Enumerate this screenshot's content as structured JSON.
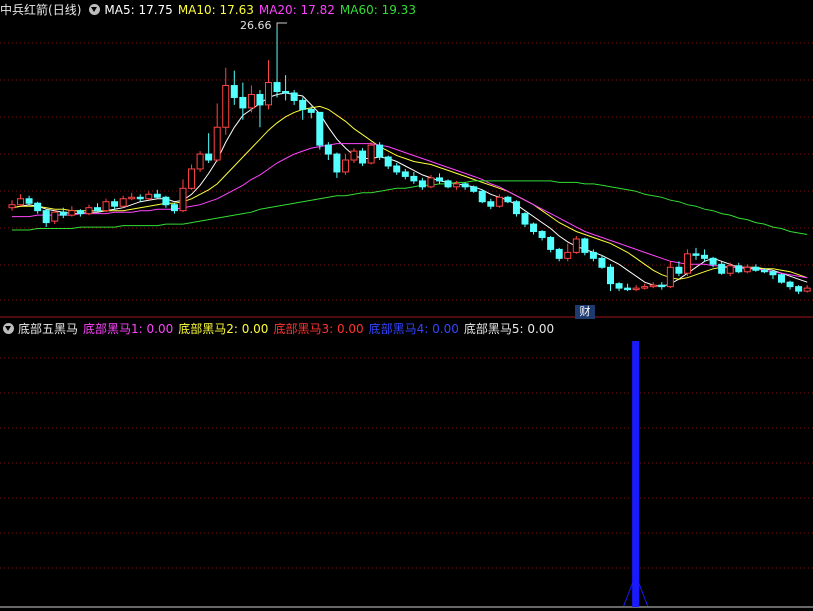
{
  "main_panel": {
    "stock_name": "中兵红箭",
    "period": "(日线)",
    "ma": [
      {
        "label": "MA5: 17.75",
        "color": "#ffffff"
      },
      {
        "label": "MA10: 17.63",
        "color": "#ffff3a"
      },
      {
        "label": "MA20: 17.82",
        "color": "#ff44ff"
      },
      {
        "label": "MA60: 19.33",
        "color": "#33dd33"
      }
    ],
    "peak_label": "26.66",
    "marker": "财"
  },
  "indicator_panel": {
    "name": "底部五黑马",
    "params": [
      {
        "label": "底部黑马1: 0.00",
        "color": "#ff44ff"
      },
      {
        "label": "底部黑马2: 0.00",
        "color": "#ffff3a"
      },
      {
        "label": "底部黑马3: 0.00",
        "color": "#ff3333"
      },
      {
        "label": "底部黑马4: 0.00",
        "color": "#3344ff"
      },
      {
        "label": "底部黑马5: 0.00",
        "color": "#e8e8e8"
      }
    ]
  },
  "colors": {
    "up": "#ff4444",
    "down": "#54ffff",
    "grid": "#7a1010",
    "signal_bar": "#1a1aff"
  },
  "chart_data": {
    "type": "candlestick",
    "candles": [
      [
        14.6,
        14.8,
        15.1,
        14.4
      ],
      [
        14.8,
        15.2,
        15.5,
        14.7
      ],
      [
        15.2,
        14.9,
        15.4,
        14.8
      ],
      [
        14.9,
        14.4,
        15.0,
        14.2
      ],
      [
        14.4,
        13.6,
        14.5,
        13.3
      ],
      [
        13.7,
        14.3,
        14.4,
        13.5
      ],
      [
        14.3,
        14.1,
        14.6,
        13.9
      ],
      [
        14.1,
        14.4,
        14.7,
        14.0
      ],
      [
        14.4,
        14.2,
        14.5,
        14.0
      ],
      [
        14.2,
        14.6,
        14.8,
        14.1
      ],
      [
        14.6,
        14.4,
        14.9,
        14.3
      ],
      [
        14.4,
        15.0,
        15.2,
        14.3
      ],
      [
        15.0,
        14.7,
        15.2,
        14.5
      ],
      [
        14.7,
        15.2,
        15.4,
        14.6
      ],
      [
        15.2,
        15.3,
        15.6,
        15.1
      ],
      [
        15.3,
        15.2,
        15.5,
        15.0
      ],
      [
        15.2,
        15.5,
        15.7,
        15.1
      ],
      [
        15.5,
        15.3,
        15.8,
        15.2
      ],
      [
        15.3,
        14.8,
        15.4,
        14.6
      ],
      [
        14.8,
        14.4,
        14.9,
        14.2
      ],
      [
        14.4,
        15.9,
        16.5,
        14.3
      ],
      [
        15.9,
        17.2,
        17.5,
        15.8
      ],
      [
        17.2,
        18.2,
        18.4,
        17.0
      ],
      [
        18.2,
        17.8,
        19.6,
        17.6
      ],
      [
        17.8,
        20.0,
        21.6,
        17.7
      ],
      [
        20.0,
        22.8,
        24.0,
        19.5
      ],
      [
        22.8,
        22.0,
        23.8,
        21.5
      ],
      [
        22.0,
        21.3,
        23.0,
        20.5
      ],
      [
        21.3,
        22.2,
        22.8,
        21.0
      ],
      [
        22.2,
        21.5,
        22.5,
        20.0
      ],
      [
        21.5,
        23.0,
        24.5,
        21.2
      ],
      [
        23.0,
        22.4,
        26.66,
        22.0
      ],
      [
        22.4,
        22.3,
        23.5,
        21.8
      ],
      [
        22.3,
        21.8,
        22.5,
        21.5
      ],
      [
        21.8,
        21.2,
        22.0,
        20.5
      ],
      [
        21.2,
        21.0,
        21.4,
        20.6
      ],
      [
        21.0,
        18.8,
        21.0,
        18.5
      ],
      [
        18.8,
        18.2,
        19.0,
        17.8
      ],
      [
        18.2,
        17.0,
        18.3,
        16.6
      ],
      [
        17.0,
        17.8,
        18.2,
        16.8
      ],
      [
        17.8,
        18.4,
        18.6,
        17.6
      ],
      [
        18.4,
        17.6,
        18.6,
        17.4
      ],
      [
        17.6,
        18.8,
        19.0,
        17.5
      ],
      [
        18.8,
        18.0,
        19.0,
        17.8
      ],
      [
        18.0,
        17.4,
        18.1,
        17.2
      ],
      [
        17.4,
        17.0,
        17.6,
        16.8
      ],
      [
        17.0,
        16.7,
        17.2,
        16.5
      ],
      [
        16.7,
        16.4,
        17.0,
        16.2
      ],
      [
        16.4,
        16.0,
        16.6,
        15.8
      ],
      [
        16.0,
        16.6,
        16.8,
        15.9
      ],
      [
        16.6,
        16.4,
        16.9,
        16.2
      ],
      [
        16.4,
        16.0,
        16.5,
        15.9
      ],
      [
        16.0,
        16.2,
        16.4,
        15.8
      ],
      [
        16.2,
        16.0,
        16.3,
        15.8
      ],
      [
        16.0,
        15.7,
        16.1,
        15.6
      ],
      [
        15.7,
        15.0,
        15.8,
        14.9
      ],
      [
        15.0,
        14.7,
        15.2,
        14.5
      ],
      [
        14.7,
        15.3,
        15.5,
        14.6
      ],
      [
        15.3,
        15.0,
        15.4,
        14.9
      ],
      [
        15.0,
        14.2,
        15.1,
        14.0
      ],
      [
        14.2,
        13.5,
        14.3,
        13.3
      ],
      [
        13.5,
        13.0,
        13.6,
        12.8
      ],
      [
        13.0,
        12.6,
        13.1,
        12.4
      ],
      [
        12.6,
        11.8,
        12.7,
        11.6
      ],
      [
        11.8,
        11.2,
        11.9,
        11.0
      ],
      [
        11.2,
        11.6,
        12.2,
        11.0
      ],
      [
        11.6,
        12.5,
        12.7,
        11.5
      ],
      [
        12.5,
        11.6,
        12.6,
        11.4
      ],
      [
        11.6,
        11.2,
        11.8,
        11.0
      ],
      [
        11.2,
        10.6,
        11.4,
        10.5
      ],
      [
        10.6,
        9.5,
        10.8,
        9.0
      ],
      [
        9.5,
        9.2,
        9.6,
        9.0
      ],
      [
        9.2,
        9.1,
        9.5,
        9.0
      ],
      [
        9.1,
        9.2,
        9.4,
        9.0
      ],
      [
        9.2,
        9.3,
        9.5,
        9.1
      ],
      [
        9.3,
        9.4,
        9.6,
        9.2
      ],
      [
        9.4,
        9.3,
        9.6,
        9.1
      ],
      [
        9.3,
        10.6,
        11.0,
        9.2
      ],
      [
        10.6,
        10.2,
        11.0,
        10.0
      ],
      [
        10.2,
        11.5,
        11.8,
        10.0
      ],
      [
        11.5,
        11.4,
        11.9,
        11.1
      ],
      [
        11.4,
        11.2,
        11.8,
        11.0
      ],
      [
        11.2,
        10.8,
        11.3,
        10.6
      ],
      [
        10.8,
        10.2,
        11.0,
        10.1
      ],
      [
        10.2,
        10.7,
        10.9,
        10.0
      ],
      [
        10.7,
        10.3,
        10.9,
        10.2
      ],
      [
        10.3,
        10.6,
        10.8,
        10.2
      ],
      [
        10.6,
        10.4,
        10.8,
        10.3
      ],
      [
        10.4,
        10.3,
        10.5,
        10.2
      ],
      [
        10.3,
        10.1,
        10.4,
        9.8
      ],
      [
        10.1,
        9.6,
        10.2,
        9.5
      ],
      [
        9.6,
        9.3,
        9.7,
        9.1
      ],
      [
        9.3,
        9.0,
        9.4,
        8.8
      ],
      [
        9.0,
        9.2,
        9.4,
        8.9
      ]
    ],
    "ma_series": [
      {
        "values": [
          14.6,
          14.7,
          14.8,
          14.7,
          14.5,
          14.4,
          14.3,
          14.2,
          14.2,
          14.3,
          14.3,
          14.4,
          14.5,
          14.6,
          14.8,
          15.0,
          15.1,
          15.2,
          15.2,
          15.0,
          15.1,
          15.5,
          16.1,
          16.9,
          17.8,
          19.0,
          20.0,
          20.8,
          21.2,
          21.6,
          22.0,
          22.2,
          22.3,
          22.2,
          22.1,
          21.5,
          20.9,
          20.0,
          19.2,
          18.6,
          18.1,
          17.9,
          17.9,
          18.0,
          17.9,
          17.7,
          17.4,
          17.1,
          16.8,
          16.6,
          16.4,
          16.3,
          16.2,
          16.1,
          16.0,
          15.8,
          15.5,
          15.3,
          15.1,
          14.8,
          14.4,
          14.0,
          13.6,
          13.2,
          12.7,
          12.3,
          12.0,
          11.8,
          11.6,
          11.4,
          11.1,
          10.8,
          10.4,
          10.0,
          9.6,
          9.4,
          9.3,
          9.5,
          9.8,
          10.2,
          10.6,
          11.0,
          11.2,
          11.0,
          10.8,
          10.6,
          10.5,
          10.5,
          10.5,
          10.4,
          10.2,
          10.0,
          9.8,
          9.6
        ]
      },
      {
        "values": [
          14.6,
          14.7,
          14.7,
          14.7,
          14.6,
          14.5,
          14.5,
          14.4,
          14.4,
          14.4,
          14.4,
          14.4,
          14.4,
          14.4,
          14.5,
          14.6,
          14.7,
          14.8,
          14.9,
          14.9,
          15.0,
          15.2,
          15.5,
          15.8,
          16.2,
          16.8,
          17.4,
          18.0,
          18.6,
          19.2,
          19.8,
          20.3,
          20.7,
          21.0,
          21.2,
          21.3,
          21.4,
          21.2,
          20.8,
          20.4,
          19.9,
          19.5,
          19.1,
          18.7,
          18.4,
          18.1,
          17.9,
          17.7,
          17.6,
          17.5,
          17.3,
          17.1,
          16.9,
          16.7,
          16.5,
          16.3,
          16.1,
          15.9,
          15.7,
          15.4,
          15.1,
          14.8,
          14.4,
          14.0,
          13.6,
          13.3,
          13.0,
          12.8,
          12.6,
          12.4,
          12.2,
          11.9,
          11.6,
          11.2,
          10.8,
          10.4,
          10.1,
          9.9,
          9.8,
          9.9,
          10.1,
          10.3,
          10.5,
          10.6,
          10.6,
          10.6,
          10.6,
          10.6,
          10.5,
          10.5,
          10.4,
          10.3,
          10.1,
          9.9
        ]
      },
      {
        "values": [
          14.0,
          14.0,
          14.0,
          14.1,
          14.1,
          14.1,
          14.1,
          14.1,
          14.2,
          14.2,
          14.2,
          14.2,
          14.3,
          14.3,
          14.3,
          14.4,
          14.4,
          14.5,
          14.5,
          14.5,
          14.6,
          14.7,
          14.8,
          15.0,
          15.2,
          15.5,
          15.8,
          16.1,
          16.5,
          16.8,
          17.2,
          17.6,
          17.9,
          18.2,
          18.4,
          18.6,
          18.7,
          18.8,
          18.9,
          18.9,
          18.9,
          18.9,
          18.9,
          18.8,
          18.7,
          18.5,
          18.3,
          18.1,
          17.9,
          17.7,
          17.5,
          17.3,
          17.1,
          16.9,
          16.7,
          16.5,
          16.2,
          16.0,
          15.7,
          15.4,
          15.1,
          14.8,
          14.5,
          14.2,
          13.9,
          13.6,
          13.3,
          13.0,
          12.8,
          12.6,
          12.4,
          12.2,
          12.0,
          11.8,
          11.6,
          11.4,
          11.2,
          11.0,
          10.9,
          10.8,
          10.8,
          10.8,
          10.7,
          10.7,
          10.6,
          10.6,
          10.6,
          10.5,
          10.4,
          10.3,
          10.2,
          10.1,
          10.0,
          9.9
        ]
      },
      {
        "values": [
          13.1,
          13.1,
          13.1,
          13.2,
          13.2,
          13.2,
          13.2,
          13.2,
          13.3,
          13.3,
          13.3,
          13.3,
          13.3,
          13.4,
          13.4,
          13.4,
          13.4,
          13.4,
          13.5,
          13.5,
          13.5,
          13.6,
          13.7,
          13.8,
          13.9,
          14.0,
          14.1,
          14.2,
          14.3,
          14.5,
          14.6,
          14.7,
          14.8,
          14.9,
          15.0,
          15.1,
          15.2,
          15.3,
          15.4,
          15.4,
          15.5,
          15.6,
          15.6,
          15.7,
          15.8,
          15.9,
          15.9,
          16.0,
          16.1,
          16.1,
          16.2,
          16.2,
          16.3,
          16.3,
          16.4,
          16.4,
          16.4,
          16.4,
          16.4,
          16.4,
          16.4,
          16.4,
          16.4,
          16.4,
          16.3,
          16.3,
          16.3,
          16.2,
          16.2,
          16.1,
          16.0,
          15.9,
          15.8,
          15.7,
          15.5,
          15.4,
          15.3,
          15.1,
          15.0,
          14.8,
          14.7,
          14.5,
          14.4,
          14.2,
          14.1,
          13.9,
          13.8,
          13.6,
          13.5,
          13.3,
          13.2,
          13.0,
          12.9,
          12.8
        ]
      }
    ],
    "indicator": {
      "signal_index": 73,
      "value": 1
    }
  }
}
